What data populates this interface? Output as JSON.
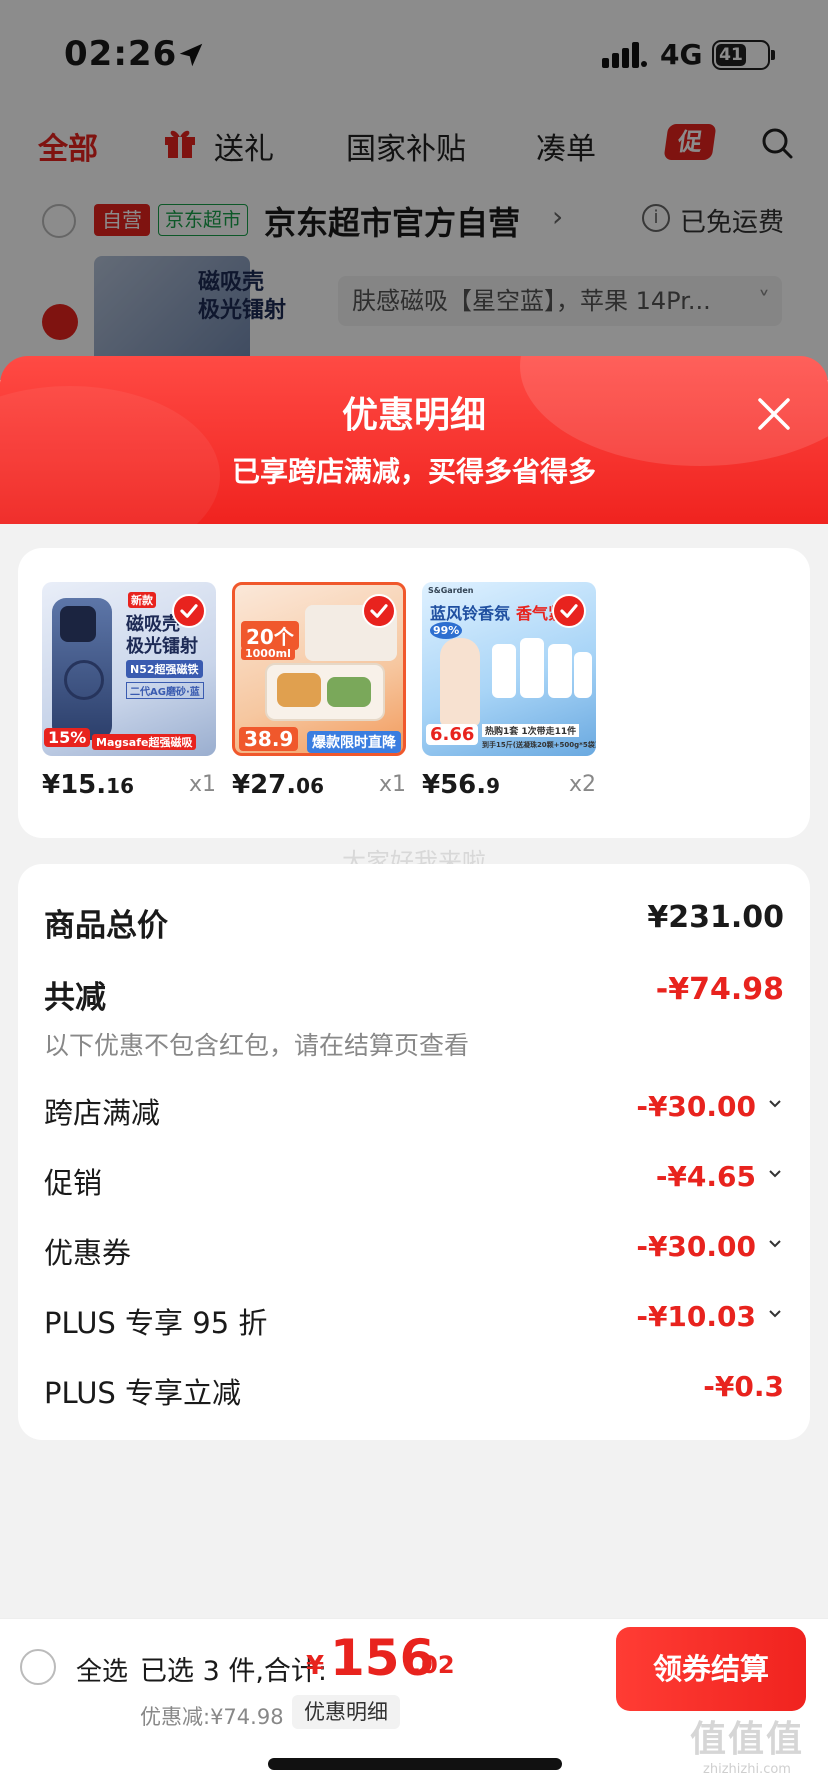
{
  "status_bar": {
    "time": "02:26",
    "network": "4G",
    "battery": "41"
  },
  "nav": {
    "all": "全部",
    "gift": "送礼",
    "subsidy": "国家补贴",
    "bundle": "凑单",
    "promo": "促"
  },
  "store": {
    "tag_self": "自营",
    "tag_jd": "京东超市",
    "name": "京东超市官方自营",
    "chevron": "›",
    "shipping": "已免运费"
  },
  "bg_item": {
    "thumb_line1": "磁吸壳",
    "thumb_line2": "极光镭射",
    "sku": "肤感磁吸【星空蓝】，苹果 14Pr...",
    "sku_chevron": "˅"
  },
  "sheet": {
    "title": "优惠明细",
    "subtitle": "已享跨店满减，买得多省得多"
  },
  "products": [
    {
      "price_int": "¥15.",
      "price_dec": "16",
      "qty": "x1",
      "badge": "新款",
      "line1": "磁吸壳",
      "line2": "极光镭射",
      "line3": "N52超强磁铁",
      "line4": "二代AG磨砂·蓝",
      "corner": "15%",
      "strip": "Magsafe超强磁吸"
    },
    {
      "price_int": "¥27.",
      "price_dec": "06",
      "qty": "x1",
      "badge": "20个",
      "size": "1000ml",
      "price_tag": "38.9",
      "strip": "爆款限时直降"
    },
    {
      "price_int": "¥56.",
      "price_dec": "9",
      "qty": "x2",
      "brand": "S&Garden",
      "line1": "蓝风铃香氛",
      "line2": "香气紧绕",
      "pct": "99%",
      "price_tag": "6.66",
      "strip": "热购1套 1次带走11件",
      "strip2": "到手15斤(送凝珠20颗+500g*5袋)"
    }
  ],
  "watermark": "大家好我来啦",
  "summary": {
    "total_label": "商品总价",
    "total_value": "¥231.00",
    "reduce_label": "共减",
    "reduce_value": "-¥74.98",
    "reduce_note": "以下优惠不包含红包，请在结算页查看",
    "lines": [
      {
        "label": "跨店满减",
        "value": "-¥30.00"
      },
      {
        "label": "促销",
        "value": "-¥4.65"
      },
      {
        "label": "优惠券",
        "value": "-¥30.00"
      },
      {
        "label": "PLUS 专享 95 折",
        "value": "-¥10.03"
      },
      {
        "label": "PLUS 专享立减",
        "value": "-¥0.3"
      }
    ]
  },
  "bottom": {
    "select_all": "全选",
    "selected": "已选 3 件,合计:",
    "currency": "¥",
    "total_int": "156",
    "total_dec": ".02",
    "discount": "优惠减:¥74.98",
    "detail": "优惠明细",
    "checkout": "领券结算"
  },
  "site_mark": {
    "big": "值值值",
    "small": "zhizhizhi.com"
  },
  "colors": {
    "accent": "#e8231e",
    "background": "#f2f2f2"
  }
}
